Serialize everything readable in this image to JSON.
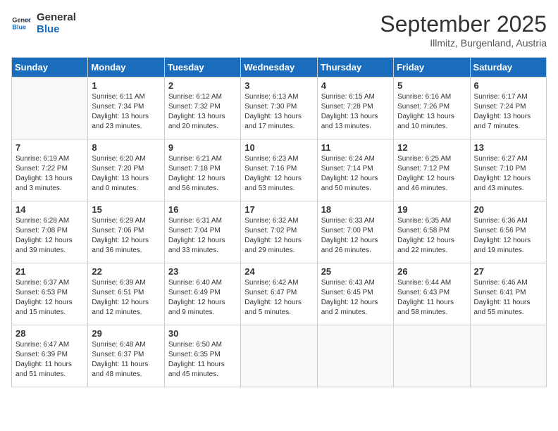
{
  "header": {
    "logo_line1": "General",
    "logo_line2": "Blue",
    "month": "September 2025",
    "location": "Illmitz, Burgenland, Austria"
  },
  "weekdays": [
    "Sunday",
    "Monday",
    "Tuesday",
    "Wednesday",
    "Thursday",
    "Friday",
    "Saturday"
  ],
  "weeks": [
    [
      {
        "day": "",
        "info": ""
      },
      {
        "day": "1",
        "info": "Sunrise: 6:11 AM\nSunset: 7:34 PM\nDaylight: 13 hours\nand 23 minutes."
      },
      {
        "day": "2",
        "info": "Sunrise: 6:12 AM\nSunset: 7:32 PM\nDaylight: 13 hours\nand 20 minutes."
      },
      {
        "day": "3",
        "info": "Sunrise: 6:13 AM\nSunset: 7:30 PM\nDaylight: 13 hours\nand 17 minutes."
      },
      {
        "day": "4",
        "info": "Sunrise: 6:15 AM\nSunset: 7:28 PM\nDaylight: 13 hours\nand 13 minutes."
      },
      {
        "day": "5",
        "info": "Sunrise: 6:16 AM\nSunset: 7:26 PM\nDaylight: 13 hours\nand 10 minutes."
      },
      {
        "day": "6",
        "info": "Sunrise: 6:17 AM\nSunset: 7:24 PM\nDaylight: 13 hours\nand 7 minutes."
      }
    ],
    [
      {
        "day": "7",
        "info": "Sunrise: 6:19 AM\nSunset: 7:22 PM\nDaylight: 13 hours\nand 3 minutes."
      },
      {
        "day": "8",
        "info": "Sunrise: 6:20 AM\nSunset: 7:20 PM\nDaylight: 13 hours\nand 0 minutes."
      },
      {
        "day": "9",
        "info": "Sunrise: 6:21 AM\nSunset: 7:18 PM\nDaylight: 12 hours\nand 56 minutes."
      },
      {
        "day": "10",
        "info": "Sunrise: 6:23 AM\nSunset: 7:16 PM\nDaylight: 12 hours\nand 53 minutes."
      },
      {
        "day": "11",
        "info": "Sunrise: 6:24 AM\nSunset: 7:14 PM\nDaylight: 12 hours\nand 50 minutes."
      },
      {
        "day": "12",
        "info": "Sunrise: 6:25 AM\nSunset: 7:12 PM\nDaylight: 12 hours\nand 46 minutes."
      },
      {
        "day": "13",
        "info": "Sunrise: 6:27 AM\nSunset: 7:10 PM\nDaylight: 12 hours\nand 43 minutes."
      }
    ],
    [
      {
        "day": "14",
        "info": "Sunrise: 6:28 AM\nSunset: 7:08 PM\nDaylight: 12 hours\nand 39 minutes."
      },
      {
        "day": "15",
        "info": "Sunrise: 6:29 AM\nSunset: 7:06 PM\nDaylight: 12 hours\nand 36 minutes."
      },
      {
        "day": "16",
        "info": "Sunrise: 6:31 AM\nSunset: 7:04 PM\nDaylight: 12 hours\nand 33 minutes."
      },
      {
        "day": "17",
        "info": "Sunrise: 6:32 AM\nSunset: 7:02 PM\nDaylight: 12 hours\nand 29 minutes."
      },
      {
        "day": "18",
        "info": "Sunrise: 6:33 AM\nSunset: 7:00 PM\nDaylight: 12 hours\nand 26 minutes."
      },
      {
        "day": "19",
        "info": "Sunrise: 6:35 AM\nSunset: 6:58 PM\nDaylight: 12 hours\nand 22 minutes."
      },
      {
        "day": "20",
        "info": "Sunrise: 6:36 AM\nSunset: 6:56 PM\nDaylight: 12 hours\nand 19 minutes."
      }
    ],
    [
      {
        "day": "21",
        "info": "Sunrise: 6:37 AM\nSunset: 6:53 PM\nDaylight: 12 hours\nand 15 minutes."
      },
      {
        "day": "22",
        "info": "Sunrise: 6:39 AM\nSunset: 6:51 PM\nDaylight: 12 hours\nand 12 minutes."
      },
      {
        "day": "23",
        "info": "Sunrise: 6:40 AM\nSunset: 6:49 PM\nDaylight: 12 hours\nand 9 minutes."
      },
      {
        "day": "24",
        "info": "Sunrise: 6:42 AM\nSunset: 6:47 PM\nDaylight: 12 hours\nand 5 minutes."
      },
      {
        "day": "25",
        "info": "Sunrise: 6:43 AM\nSunset: 6:45 PM\nDaylight: 12 hours\nand 2 minutes."
      },
      {
        "day": "26",
        "info": "Sunrise: 6:44 AM\nSunset: 6:43 PM\nDaylight: 11 hours\nand 58 minutes."
      },
      {
        "day": "27",
        "info": "Sunrise: 6:46 AM\nSunset: 6:41 PM\nDaylight: 11 hours\nand 55 minutes."
      }
    ],
    [
      {
        "day": "28",
        "info": "Sunrise: 6:47 AM\nSunset: 6:39 PM\nDaylight: 11 hours\nand 51 minutes."
      },
      {
        "day": "29",
        "info": "Sunrise: 6:48 AM\nSunset: 6:37 PM\nDaylight: 11 hours\nand 48 minutes."
      },
      {
        "day": "30",
        "info": "Sunrise: 6:50 AM\nSunset: 6:35 PM\nDaylight: 11 hours\nand 45 minutes."
      },
      {
        "day": "",
        "info": ""
      },
      {
        "day": "",
        "info": ""
      },
      {
        "day": "",
        "info": ""
      },
      {
        "day": "",
        "info": ""
      }
    ]
  ]
}
